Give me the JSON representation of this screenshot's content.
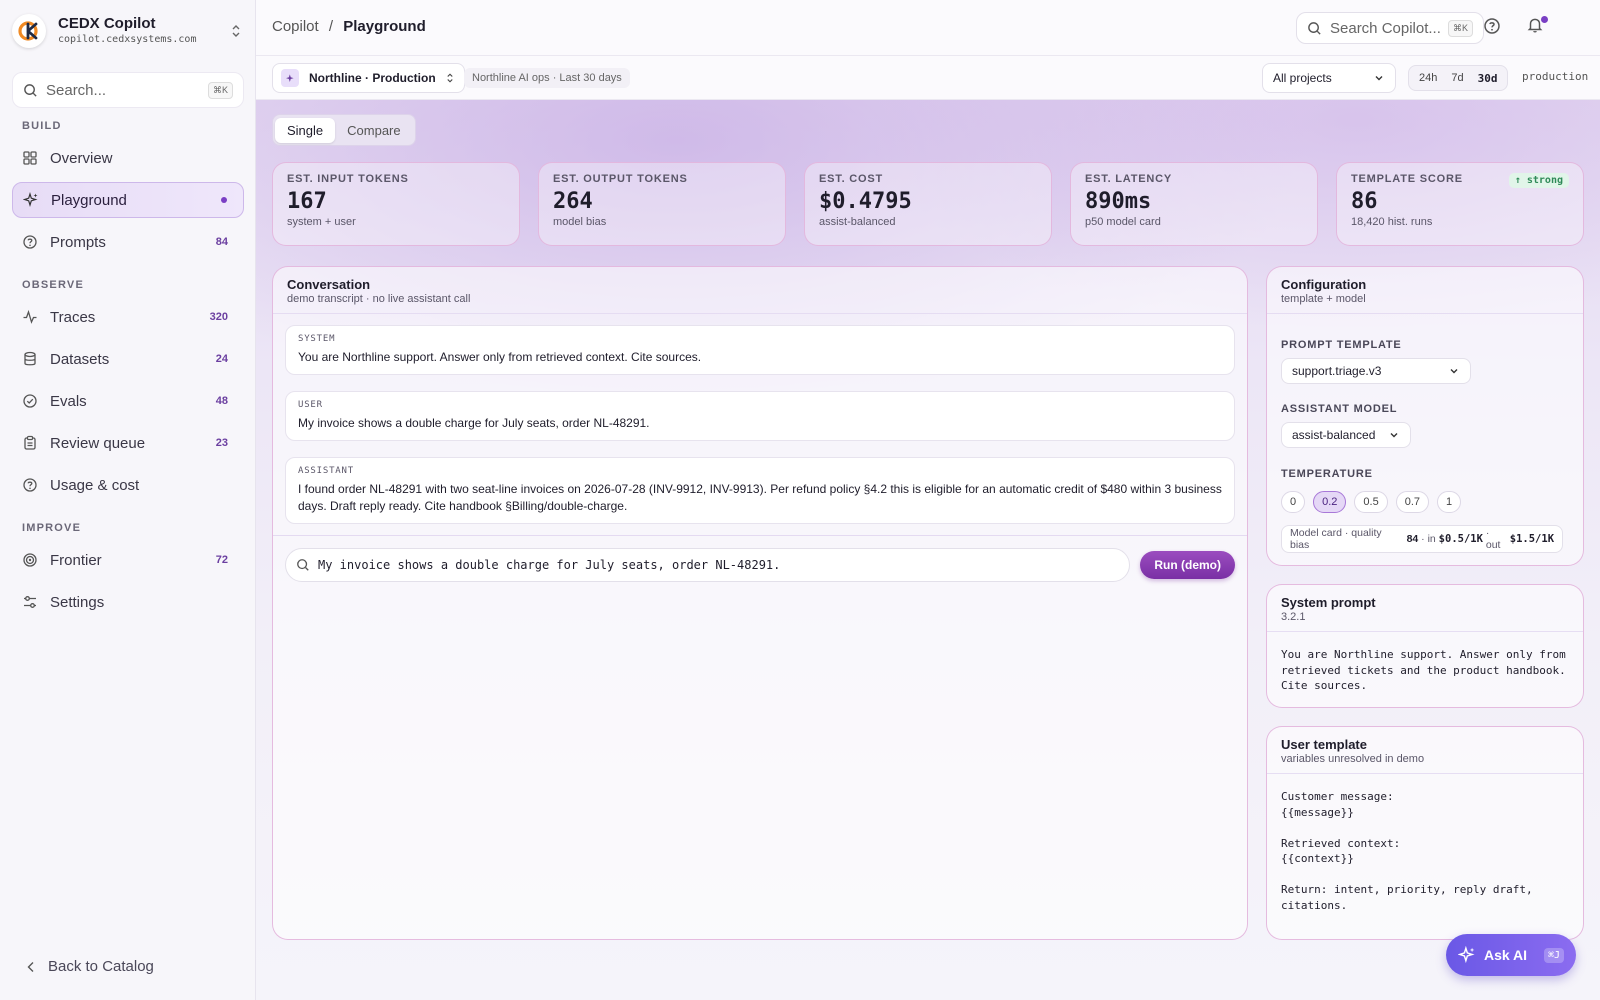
{
  "app": {
    "name": "CEDX Copilot",
    "domain": "copilot.cedxsystems.com"
  },
  "sidebar": {
    "search": {
      "placeholder": "Search...",
      "shortcut": "⌘K"
    },
    "sections": [
      {
        "label": "BUILD"
      },
      {
        "label": "OBSERVE"
      },
      {
        "label": "IMPROVE"
      }
    ],
    "items": [
      {
        "label": "Overview",
        "count": "",
        "icon": "grid-icon"
      },
      {
        "label": "Playground",
        "count": "",
        "icon": "sparkle-icon",
        "active": true
      },
      {
        "label": "Prompts",
        "count": "84",
        "icon": "help-circle-icon"
      },
      {
        "label": "Traces",
        "count": "320",
        "icon": "activity-icon"
      },
      {
        "label": "Datasets",
        "count": "24",
        "icon": "database-icon"
      },
      {
        "label": "Evals",
        "count": "48",
        "icon": "check-circle-icon"
      },
      {
        "label": "Review queue",
        "count": "23",
        "icon": "clipboard-icon"
      },
      {
        "label": "Usage & cost",
        "count": "",
        "icon": "help-circle-icon"
      },
      {
        "label": "Frontier",
        "count": "72",
        "icon": "target-icon"
      },
      {
        "label": "Settings",
        "count": "",
        "icon": "sliders-icon"
      }
    ],
    "back_label": "Back to Catalog"
  },
  "topbar": {
    "crumb_root": "Copilot",
    "crumb_sep": "/",
    "crumb_current": "Playground",
    "search_placeholder": "Search Copilot...",
    "search_shortcut": "⌘K"
  },
  "subbar": {
    "project": "Northline · Production",
    "meta": "Northline AI ops · Last 30 days",
    "filter": "All projects",
    "ranges": [
      "24h",
      "7d",
      "30d"
    ],
    "selected_range": "30d",
    "env": "production"
  },
  "mode_tabs": [
    "Single",
    "Compare"
  ],
  "stats": [
    {
      "label": "EST. INPUT TOKENS",
      "value": "167",
      "sub": "system + user"
    },
    {
      "label": "EST. OUTPUT TOKENS",
      "value": "264",
      "sub": "model bias"
    },
    {
      "label": "EST. COST",
      "value": "$0.4795",
      "sub": "assist-balanced"
    },
    {
      "label": "EST. LATENCY",
      "value": "890ms",
      "sub": "p50 model card"
    },
    {
      "label": "TEMPLATE SCORE",
      "value": "86",
      "sub": "18,420 hist. runs",
      "badge": "↑ strong"
    }
  ],
  "conversation": {
    "title": "Conversation",
    "subtitle": "demo transcript · no live assistant call",
    "messages": [
      {
        "role": "SYSTEM",
        "content": "You are Northline support. Answer only from retrieved context. Cite sources."
      },
      {
        "role": "USER",
        "content": "My invoice shows a double charge for July seats, order NL-48291."
      },
      {
        "role": "ASSISTANT",
        "content": "I found order NL-48291 with two seat-line invoices on 2026-07-28 (INV-9912, INV-9913). Per refund policy §4.2 this is eligible for an automatic credit of $480 within 3 business days. Draft reply ready. Cite handbook §Billing/double-charge."
      }
    ],
    "input_value": "My invoice shows a double charge for July seats, order NL-48291.",
    "run_label": "Run (demo)"
  },
  "configuration": {
    "title": "Configuration",
    "subtitle": "template + model",
    "template_label": "PROMPT TEMPLATE",
    "template_value": "support.triage.v3",
    "model_label": "ASSISTANT MODEL",
    "model_value": "assist-balanced",
    "temp_label": "TEMPERATURE",
    "temps": [
      "0",
      "0.2",
      "0.5",
      "0.7",
      "1"
    ],
    "selected_temp": "0.2",
    "model_card": {
      "prefix": "Model card · quality bias",
      "bias": "84",
      "in_label": "· in",
      "in_price": "$0.5/1K",
      "out_label": "· out",
      "out_price": "$1.5/1K"
    }
  },
  "system_prompt": {
    "title": "System prompt",
    "version": "3.2.1",
    "text": "You are Northline support. Answer only from\nretrieved tickets and the product handbook.\nCite sources."
  },
  "user_template": {
    "title": "User template",
    "subtitle": "variables unresolved in demo",
    "text": "Customer message:\n{{message}}\n\nRetrieved context:\n{{context}}\n\nReturn: intent, priority, reply draft,\ncitations."
  },
  "ask_ai": {
    "label": "Ask AI",
    "shortcut": "⌘J"
  },
  "colors": {
    "accent": "#7a3fc4",
    "run_button": "#8a3cb4",
    "ask_ai": "#7a63ec",
    "strong_badge": "#2f8a58"
  }
}
